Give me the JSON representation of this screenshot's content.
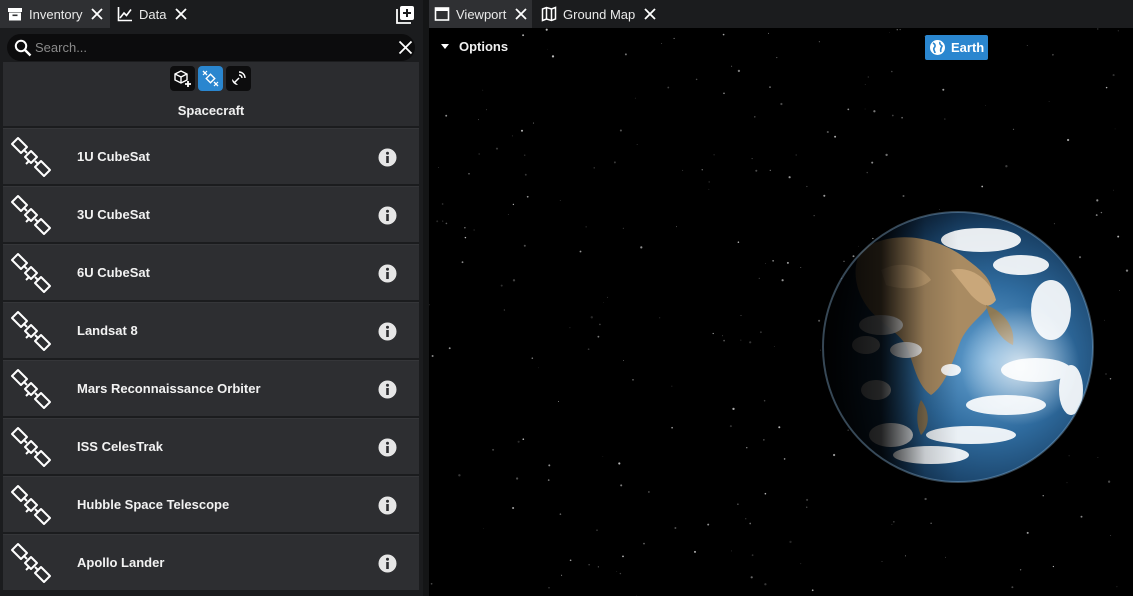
{
  "left_tabs": [
    {
      "label": "Inventory",
      "icon": "archive-box-icon"
    },
    {
      "label": "Data",
      "icon": "line-chart-icon"
    }
  ],
  "right_tabs": [
    {
      "label": "Viewport",
      "icon": "window-icon"
    },
    {
      "label": "Ground Map",
      "icon": "map-icon"
    }
  ],
  "search": {
    "placeholder": "Search...",
    "value": ""
  },
  "filters": [
    {
      "icon": "cube-add-icon",
      "active": false
    },
    {
      "icon": "satellite-icon",
      "active": true
    },
    {
      "icon": "ground-station-icon",
      "active": false
    }
  ],
  "category": "Spacecraft",
  "assets": [
    {
      "name": "1U CubeSat"
    },
    {
      "name": "3U CubeSat"
    },
    {
      "name": "6U CubeSat"
    },
    {
      "name": "Landsat 8"
    },
    {
      "name": "Mars Reconnaissance Orbiter"
    },
    {
      "name": "ISS CelesTrak"
    },
    {
      "name": "Hubble Space Telescope"
    },
    {
      "name": "Apollo Lander"
    }
  ],
  "viewport": {
    "options_label": "Options",
    "body_button_label": "Earth"
  },
  "colors": {
    "accent": "#2a86cf",
    "panel_bg": "#1b1c1e",
    "row_bg": "#2d2e31",
    "viewport_bg": "#000000"
  }
}
